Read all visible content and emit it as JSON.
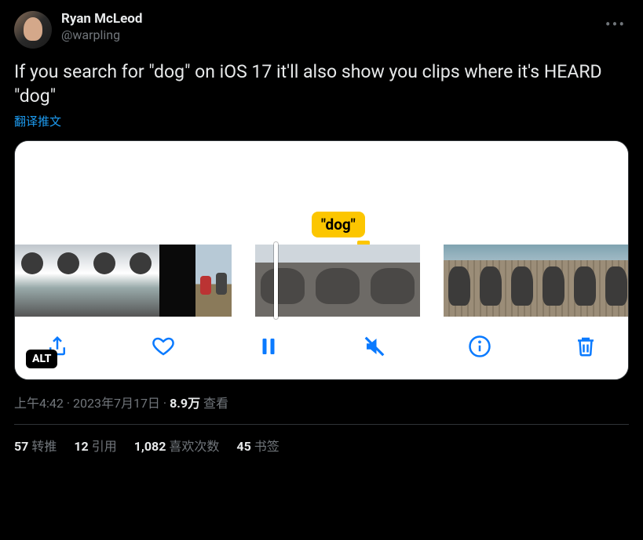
{
  "author": {
    "display_name": "Ryan McLeod",
    "handle": "@warpling"
  },
  "tweet_text": "If you search for \"dog\" on iOS 17 it'll also show you clips where it's HEARD \"dog\"",
  "translate_label": "翻译推文",
  "media": {
    "tooltip_text": "\"dog\"",
    "alt_badge": "ALT",
    "toolbar": {
      "share": "share",
      "like": "like",
      "pause": "pause",
      "mute": "mute",
      "info": "info",
      "delete": "delete"
    }
  },
  "meta": {
    "time": "上午4:42",
    "sep1": " · ",
    "date": "2023年7月17日",
    "sep2": " · ",
    "views_value": "8.9万",
    "views_label": " 查看"
  },
  "stats": {
    "retweets_value": "57",
    "retweets_label": "转推",
    "quotes_value": "12",
    "quotes_label": "引用",
    "likes_value": "1,082",
    "likes_label": "喜欢次数",
    "bookmarks_value": "45",
    "bookmarks_label": "书签"
  }
}
